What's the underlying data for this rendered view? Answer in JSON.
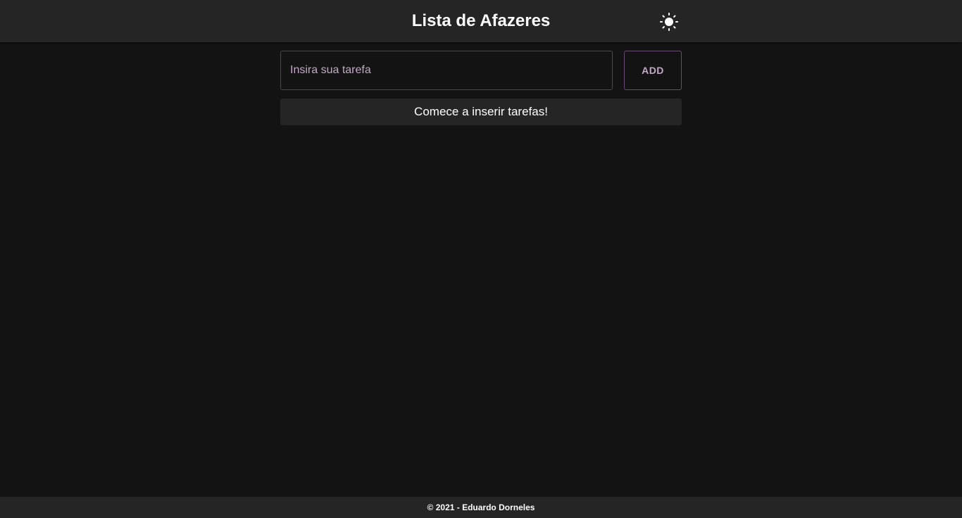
{
  "header": {
    "title": "Lista de Afazeres",
    "theme_icon": "sun-icon"
  },
  "task_form": {
    "input_value": "",
    "input_placeholder": "Insira sua tarefa",
    "add_label": "ADD"
  },
  "task_list": {
    "empty_message": "Comece a inserir tarefas!"
  },
  "footer": {
    "text": "© 2021 - Eduardo Dorneles"
  },
  "colors": {
    "background": "#131313",
    "surface": "#252525",
    "accent": "#c2a8c6",
    "accent_border": "#6b4a73"
  }
}
